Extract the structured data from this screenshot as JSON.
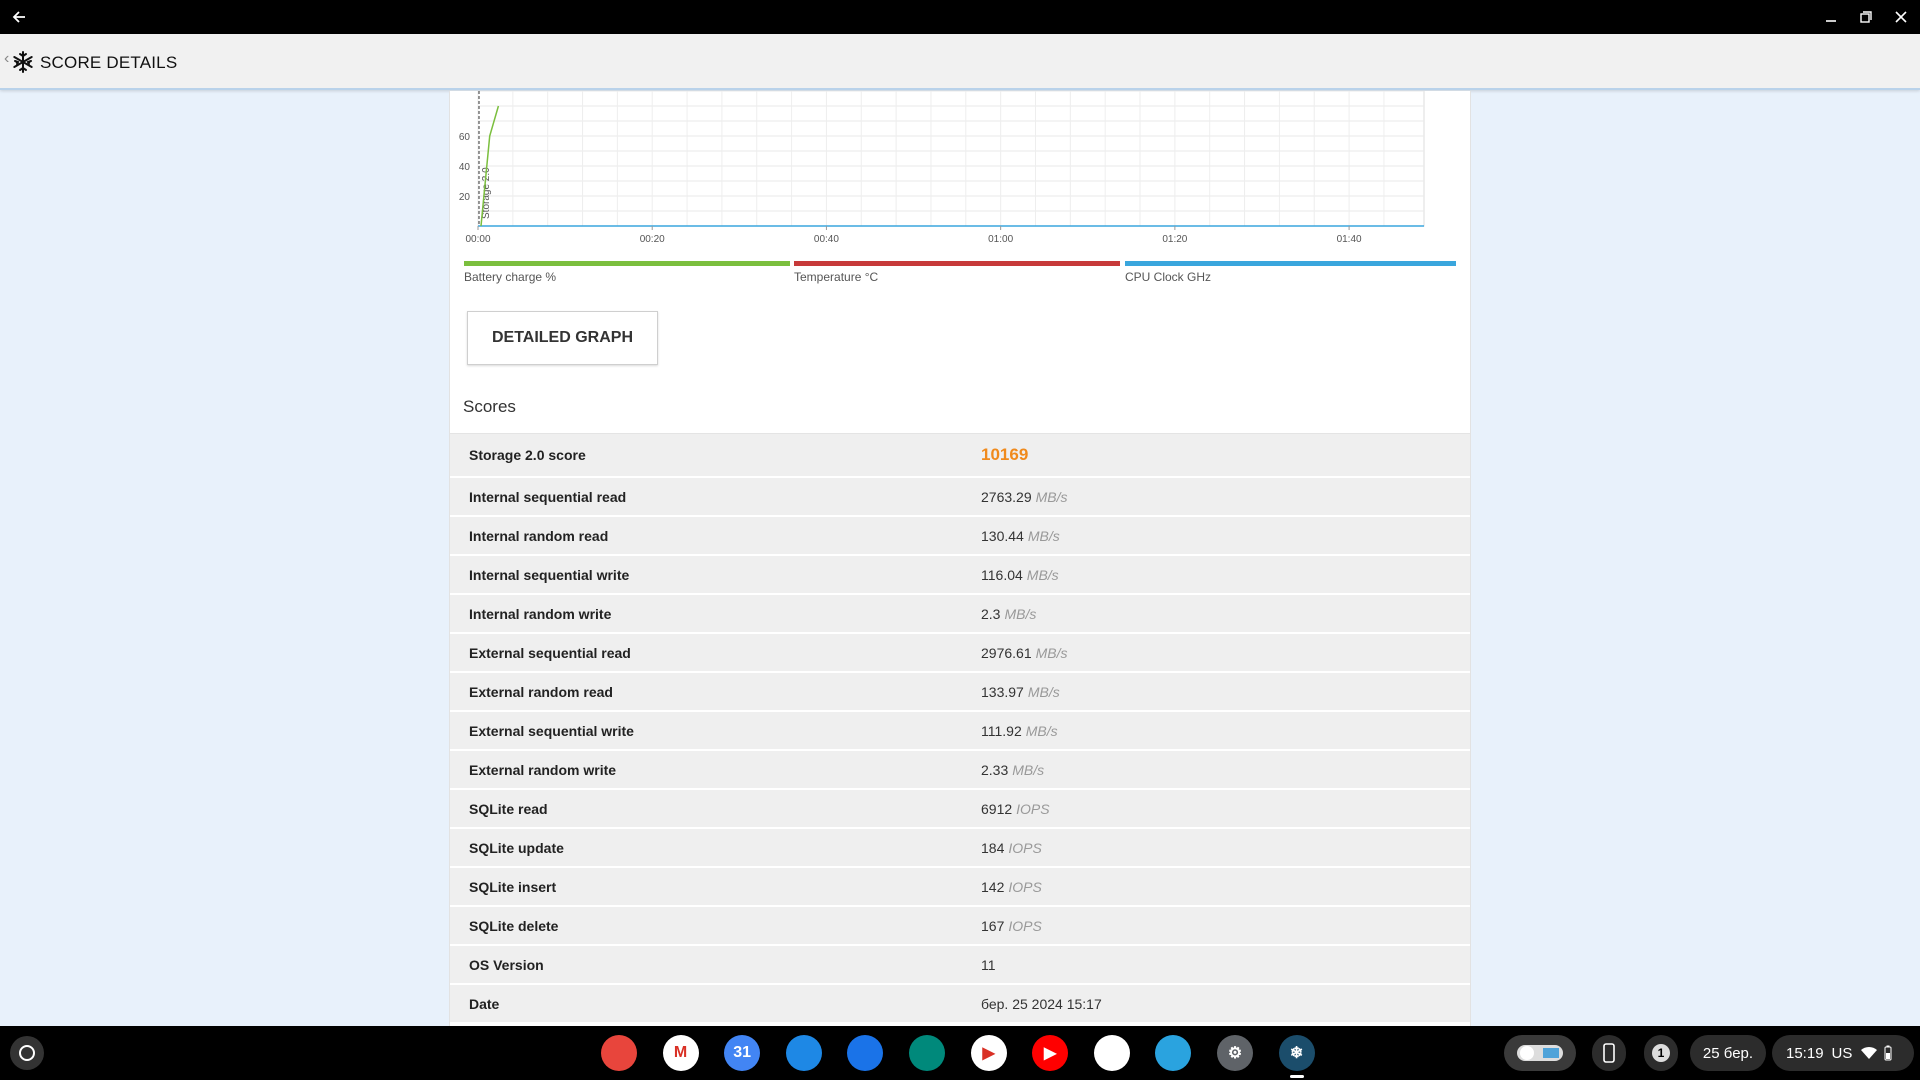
{
  "window": {
    "back_icon": "back-arrow-icon"
  },
  "appbar": {
    "title": "SCORE DETAILS",
    "logo_icon": "snowflake-icon"
  },
  "chart_data": {
    "type": "line",
    "x_ticks": [
      "00:00",
      "00:20",
      "00:40",
      "01:00",
      "01:20",
      "01:40"
    ],
    "y_ticks": [
      "20",
      "40",
      "60"
    ],
    "annotations": [
      {
        "label": "Storage 2.0"
      }
    ],
    "series": [
      {
        "name": "Battery charge %",
        "color": "#7bbf3e",
        "x": [
          "00:00",
          "00:01",
          "00:02"
        ],
        "y": [
          0,
          60,
          80
        ]
      },
      {
        "name": "Temperature °C",
        "color": "#c73a3a",
        "x": [],
        "y": []
      },
      {
        "name": "CPU Clock GHz",
        "color": "#3aa6dd",
        "x": [],
        "y": []
      }
    ],
    "grid": true
  },
  "legend": [
    {
      "label": "Battery charge %",
      "color": "#7bbf3e"
    },
    {
      "label": "Temperature °C",
      "color": "#c73a3a"
    },
    {
      "label": "CPU Clock GHz",
      "color": "#3aa6dd"
    }
  ],
  "detailed_graph_label": "DETAILED GRAPH",
  "scores_heading": "Scores",
  "scores": [
    {
      "name": "Storage 2.0 score",
      "value": "10169",
      "unit": ""
    },
    {
      "name": "Internal sequential read",
      "value": "2763.29",
      "unit": "MB/s"
    },
    {
      "name": "Internal random read",
      "value": "130.44",
      "unit": "MB/s"
    },
    {
      "name": "Internal sequential write",
      "value": "116.04",
      "unit": "MB/s"
    },
    {
      "name": "Internal random write",
      "value": "2.3",
      "unit": "MB/s"
    },
    {
      "name": "External sequential read",
      "value": "2976.61",
      "unit": "MB/s"
    },
    {
      "name": "External random read",
      "value": "133.97",
      "unit": "MB/s"
    },
    {
      "name": "External sequential write",
      "value": "111.92",
      "unit": "MB/s"
    },
    {
      "name": "External random write",
      "value": "2.33",
      "unit": "MB/s"
    },
    {
      "name": "SQLite read",
      "value": "6912",
      "unit": "IOPS"
    },
    {
      "name": "SQLite update",
      "value": "184",
      "unit": "IOPS"
    },
    {
      "name": "SQLite insert",
      "value": "142",
      "unit": "IOPS"
    },
    {
      "name": "SQLite delete",
      "value": "167",
      "unit": "IOPS"
    },
    {
      "name": "OS Version",
      "value": "11",
      "unit": ""
    },
    {
      "name": "Date",
      "value": "бер. 25 2024 15:17",
      "unit": ""
    }
  ],
  "shelf": {
    "apps": [
      {
        "name": "chrome-icon",
        "color": "#e8453c",
        "glyph": ""
      },
      {
        "name": "gmail-icon",
        "color": "#ffffff",
        "glyph": "M"
      },
      {
        "name": "calendar-icon",
        "color": "#4285f4",
        "glyph": "31"
      },
      {
        "name": "files-icon",
        "color": "#1e88e5",
        "glyph": ""
      },
      {
        "name": "messages-icon",
        "color": "#1a73e8",
        "glyph": ""
      },
      {
        "name": "meet-icon",
        "color": "#00897b",
        "glyph": ""
      },
      {
        "name": "play-store-icon",
        "color": "#ffffff",
        "glyph": "▶"
      },
      {
        "name": "youtube-icon",
        "color": "#ff0000",
        "glyph": "▶"
      },
      {
        "name": "photos-icon",
        "color": "#ffffff",
        "glyph": ""
      },
      {
        "name": "telegram-icon",
        "color": "#2aa3df",
        "glyph": ""
      },
      {
        "name": "settings-icon",
        "color": "#5f6368",
        "glyph": "⚙"
      },
      {
        "name": "pcmark-icon",
        "color": "#1b4d6b",
        "glyph": "❄"
      }
    ],
    "notification_count": "1",
    "date": "25 бер.",
    "time": "15:19",
    "keyboard_layout": "US"
  }
}
